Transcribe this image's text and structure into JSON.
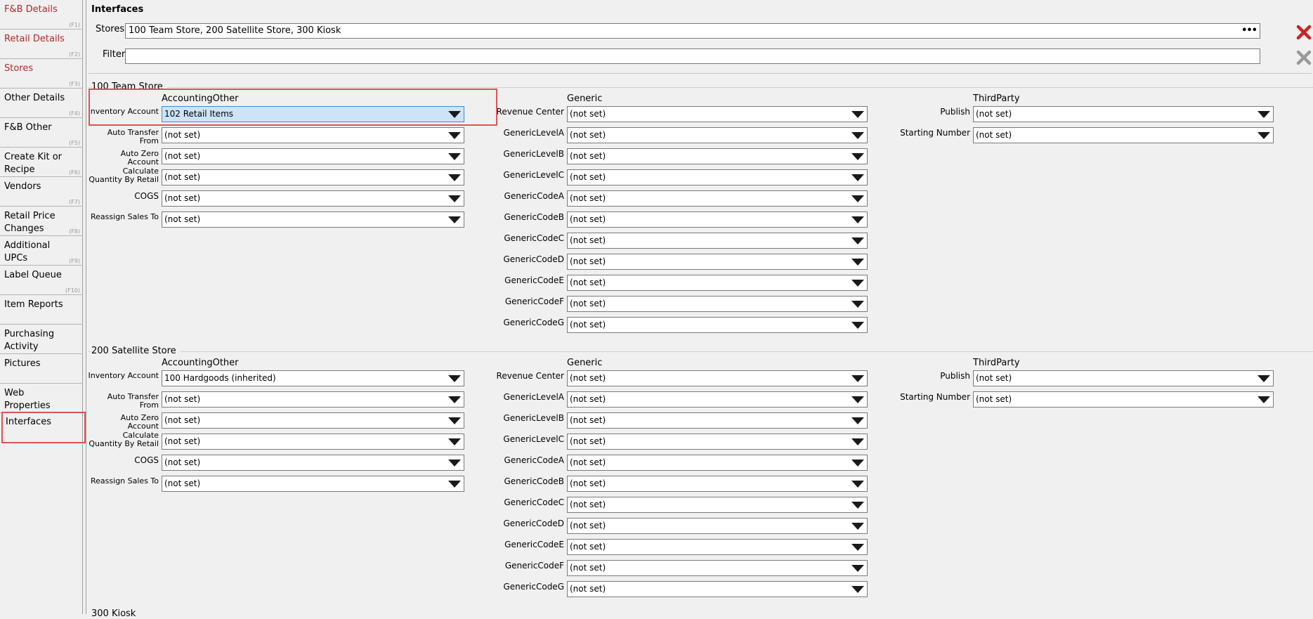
{
  "sidebar": {
    "items": [
      {
        "label": "F&B Details",
        "key": "(F1)",
        "red": true
      },
      {
        "label": "Retail Details",
        "key": "(F2)",
        "red": true
      },
      {
        "label": "Stores",
        "key": "(F3)",
        "red": true
      },
      {
        "label": "Other Details",
        "key": "(F4)",
        "red": false
      },
      {
        "label": "F&B Other",
        "key": "(F5)",
        "red": false
      },
      {
        "label": "Create Kit or Recipe",
        "key": "(F6)",
        "red": false
      },
      {
        "label": "Vendors",
        "key": "(F7)",
        "red": false
      },
      {
        "label": "Retail Price Changes",
        "key": "(F8)",
        "red": false
      },
      {
        "label": "Additional UPCs",
        "key": "(F9)",
        "red": false
      },
      {
        "label": "Label Queue",
        "key": "(F10)",
        "red": false
      },
      {
        "label": "Item Reports",
        "key": "",
        "red": false
      },
      {
        "label": "Purchasing Activity",
        "key": "",
        "red": false
      },
      {
        "label": "Pictures",
        "key": "",
        "red": false
      },
      {
        "label": "Web Properties",
        "key": "",
        "red": false
      },
      {
        "label": "Interfaces",
        "key": "",
        "red": false,
        "active": true
      }
    ]
  },
  "main": {
    "title": "Interfaces",
    "stores_label": "Stores",
    "stores_value": "100 Team Store, 200 Satellite Store, 300 Kiosk",
    "stores_more": "•••",
    "filter_label": "Filter",
    "filter_value": ""
  },
  "sections": [
    {
      "title": "100 Team Store",
      "accounting": {
        "header": "AccountingOther",
        "rows": [
          {
            "label": "Inventory Account",
            "value": "102 Retail Items",
            "selected": true
          },
          {
            "label": "Auto Transfer From",
            "value": "(not set)"
          },
          {
            "label": "Auto Zero Account",
            "value": "(not set)"
          },
          {
            "label": "Calculate Quantity By Retail",
            "value": "(not set)"
          },
          {
            "label": "COGS",
            "value": "(not set)"
          },
          {
            "label": "Reassign Sales To",
            "value": "(not set)"
          }
        ]
      },
      "generic": {
        "header": "Generic",
        "rows": [
          {
            "label": "Revenue Center",
            "value": "(not set)"
          },
          {
            "label": "GenericLevelA",
            "value": "(not set)"
          },
          {
            "label": "GenericLevelB",
            "value": "(not set)"
          },
          {
            "label": "GenericLevelC",
            "value": "(not set)"
          },
          {
            "label": "GenericCodeA",
            "value": "(not set)"
          },
          {
            "label": "GenericCodeB",
            "value": "(not set)"
          },
          {
            "label": "GenericCodeC",
            "value": "(not set)"
          },
          {
            "label": "GenericCodeD",
            "value": "(not set)"
          },
          {
            "label": "GenericCodeE",
            "value": "(not set)"
          },
          {
            "label": "GenericCodeF",
            "value": "(not set)"
          },
          {
            "label": "GenericCodeG",
            "value": "(not set)"
          }
        ]
      },
      "thirdparty": {
        "header": "ThirdParty",
        "rows": [
          {
            "label": "Publish",
            "value": "(not set)"
          },
          {
            "label": "Starting Number",
            "value": "(not set)"
          }
        ]
      }
    },
    {
      "title": "200 Satellite Store",
      "accounting": {
        "header": "AccountingOther",
        "rows": [
          {
            "label": "Inventory Account",
            "value": "100 Hardgoods (inherited)"
          },
          {
            "label": "Auto Transfer From",
            "value": "(not set)"
          },
          {
            "label": "Auto Zero Account",
            "value": "(not set)"
          },
          {
            "label": "Calculate Quantity By Retail",
            "value": "(not set)"
          },
          {
            "label": "COGS",
            "value": "(not set)"
          },
          {
            "label": "Reassign Sales To",
            "value": "(not set)"
          }
        ]
      },
      "generic": {
        "header": "Generic",
        "rows": [
          {
            "label": "Revenue Center",
            "value": "(not set)"
          },
          {
            "label": "GenericLevelA",
            "value": "(not set)"
          },
          {
            "label": "GenericLevelB",
            "value": "(not set)"
          },
          {
            "label": "GenericLevelC",
            "value": "(not set)"
          },
          {
            "label": "GenericCodeA",
            "value": "(not set)"
          },
          {
            "label": "GenericCodeB",
            "value": "(not set)"
          },
          {
            "label": "GenericCodeC",
            "value": "(not set)"
          },
          {
            "label": "GenericCodeD",
            "value": "(not set)"
          },
          {
            "label": "GenericCodeE",
            "value": "(not set)"
          },
          {
            "label": "GenericCodeF",
            "value": "(not set)"
          },
          {
            "label": "GenericCodeG",
            "value": "(not set)"
          }
        ]
      },
      "thirdparty": {
        "header": "ThirdParty",
        "rows": [
          {
            "label": "Publish",
            "value": "(not set)"
          },
          {
            "label": "Starting Number",
            "value": "(not set)"
          }
        ]
      }
    }
  ],
  "next_section_title": "300 Kiosk",
  "colors": {
    "highlight": "#e05252",
    "nav_red": "#b02a2a",
    "selected_bg": "#cde4f7",
    "clear_active": "#cc2222",
    "clear_inactive": "#9a9a9a"
  }
}
